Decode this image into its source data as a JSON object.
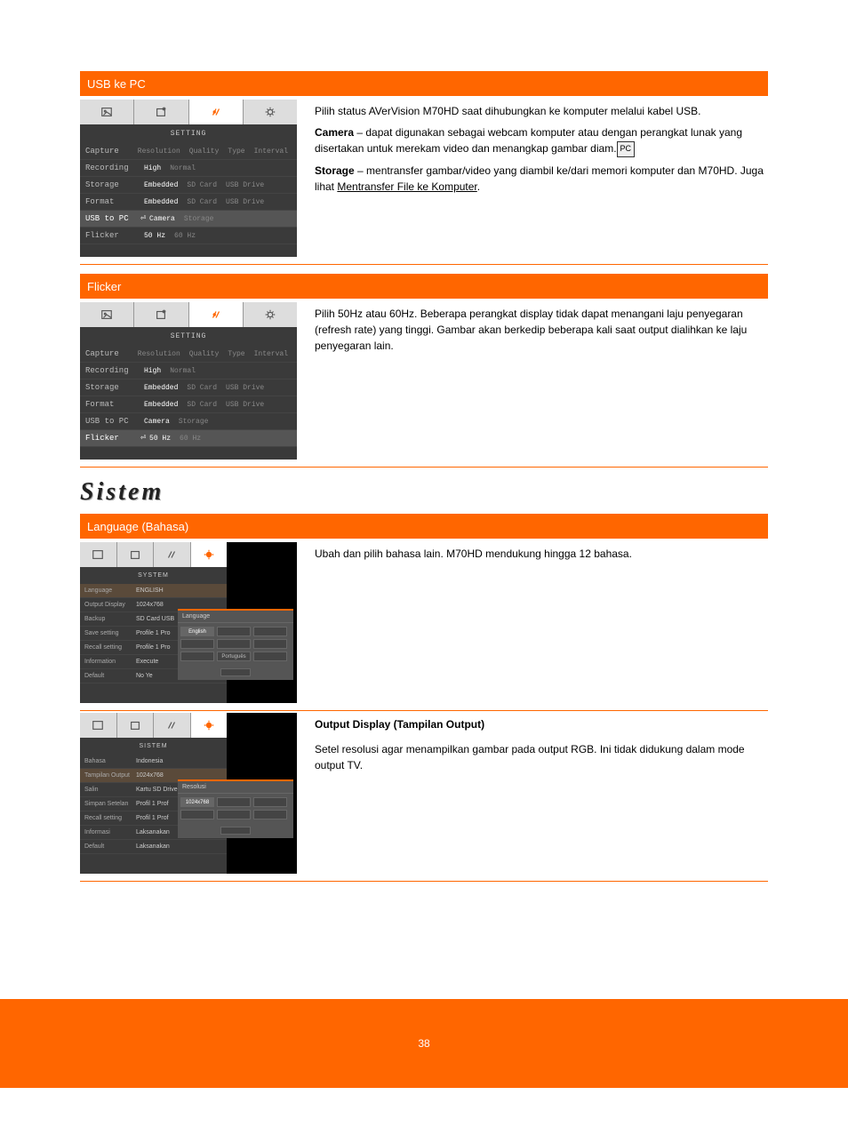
{
  "bars": {
    "usb": "USB ke PC",
    "flicker": "Flicker",
    "lang": "Language (Bahasa)",
    "output": "Output Display (Tampilan Output)"
  },
  "usb": {
    "seg1": "Pilih status AVerVision M70HD saat dihubungkan ke komputer melalui kabel USB.",
    "seg2a": "Camera",
    "seg2b": " – dapat digunakan sebagai webcam komputer atau dengan perangkat lunak yang disertakan untuk merekam video dan menangkap gambar diam.",
    "seg3a": "Storage",
    "seg3b": " – mentransfer gambar/video yang diambil ke/dari memori komputer dan M70HD. Juga lihat ",
    "seg3c": "Mentransfer File ke Komputer"
  },
  "flicker": {
    "body": "Pilih 50Hz atau 60Hz. Beberapa perangkat display tidak dapat menangani laju penyegaran (refresh rate) yang tinggi. Gambar akan berkedip beberapa kali saat output dialihkan ke laju penyegaran lain."
  },
  "section_title": "Sistem",
  "lang": {
    "body": "Ubah dan pilih bahasa lain. M70HD mendukung hingga 12 bahasa."
  },
  "output": {
    "body": "Setel resolusi agar menampilkan gambar pada output RGB. Ini tidak didukung dalam mode output TV."
  },
  "settings_menu": {
    "title": "SETTING",
    "rows": [
      {
        "lbl": "Capture",
        "opts": [
          "Resolution",
          "Quality",
          "Type",
          "Interval"
        ],
        "on": -1
      },
      {
        "lbl": "Recording",
        "opts": [
          "High",
          "Normal"
        ],
        "on": 0
      },
      {
        "lbl": "Storage",
        "opts": [
          "Embedded",
          "SD Card",
          "USB Drive"
        ],
        "on": 0
      },
      {
        "lbl": "Format",
        "opts": [
          "Embedded",
          "SD Card",
          "USB Drive"
        ],
        "on": 0
      },
      {
        "lbl": "USB to PC",
        "opts": [
          "Camera",
          "Storage"
        ],
        "on": 0
      },
      {
        "lbl": "Flicker",
        "opts": [
          "50 Hz",
          "60 Hz"
        ],
        "on": 0
      }
    ]
  },
  "system_menu": {
    "title_en": "SYSTEM",
    "title_id": "SISTEM",
    "rows_en": [
      {
        "lbl": "Language",
        "val": "ENGLISH"
      },
      {
        "lbl": "Output Display",
        "val": "1024x768"
      },
      {
        "lbl": "Backup",
        "val": "SD Card   USB"
      },
      {
        "lbl": "Save setting",
        "val": "Profile 1   Pro"
      },
      {
        "lbl": "Recall setting",
        "val": "Profile 1   Pro"
      },
      {
        "lbl": "Information",
        "val": "Execute"
      },
      {
        "lbl": "Default",
        "val": "No      Ye"
      }
    ],
    "rows_id": [
      {
        "lbl": "Bahasa",
        "val": "Indonesia"
      },
      {
        "lbl": "Tampilan Output",
        "val": "1024x768"
      },
      {
        "lbl": "Salin",
        "val": "Kartu SD   Drive USB"
      },
      {
        "lbl": "Simpan Setelan",
        "val": "Profil 1   Prof"
      },
      {
        "lbl": "Recall setting",
        "val": "Profil 1   Prof"
      },
      {
        "lbl": "Informasi",
        "val": "Laksanakan"
      },
      {
        "lbl": "Default",
        "val": "Laksanakan"
      }
    ],
    "lang_popup": {
      "title": "Language",
      "opts": [
        "English",
        "",
        "",
        "",
        "",
        "",
        "",
        "Português",
        ""
      ]
    },
    "res_popup": {
      "title": "Resolusi",
      "opts": [
        "1024x768",
        "",
        "",
        "",
        "",
        ""
      ]
    }
  },
  "footer": "38"
}
